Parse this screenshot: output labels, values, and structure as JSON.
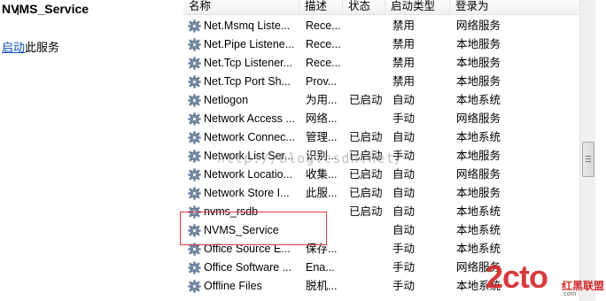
{
  "left_pane": {
    "service_title": "NVMS_Service",
    "start_link": "启动",
    "start_text": "此服务"
  },
  "columns": {
    "name": "名称",
    "desc": "描述",
    "status": "状态",
    "startup": "启动类型",
    "logon": "登录为"
  },
  "rows": [
    {
      "name": "Net.Msmq Liste...",
      "desc": "Rece...",
      "status": "",
      "startup": "禁用",
      "logon": "网络服务"
    },
    {
      "name": "Net.Pipe Listene...",
      "desc": "Rece...",
      "status": "",
      "startup": "禁用",
      "logon": "本地服务"
    },
    {
      "name": "Net.Tcp Listener...",
      "desc": "Rece...",
      "status": "",
      "startup": "禁用",
      "logon": "本地服务"
    },
    {
      "name": "Net.Tcp Port Sh...",
      "desc": "Prov...",
      "status": "",
      "startup": "禁用",
      "logon": "本地服务"
    },
    {
      "name": "Netlogon",
      "desc": "为用...",
      "status": "已启动",
      "startup": "自动",
      "logon": "本地系统"
    },
    {
      "name": "Network Access ...",
      "desc": "网络...",
      "status": "",
      "startup": "手动",
      "logon": "网络服务"
    },
    {
      "name": "Network Connec...",
      "desc": "管理...",
      "status": "已启动",
      "startup": "自动",
      "logon": "本地系统"
    },
    {
      "name": "Network List Ser...",
      "desc": "识别...",
      "status": "已启动",
      "startup": "手动",
      "logon": "本地服务"
    },
    {
      "name": "Network Locatio...",
      "desc": "收集...",
      "status": "已启动",
      "startup": "自动",
      "logon": "网络服务"
    },
    {
      "name": "Network Store I...",
      "desc": "此服...",
      "status": "已启动",
      "startup": "自动",
      "logon": "本地服务"
    },
    {
      "name": "nvms_rsdb",
      "desc": "",
      "status": "已启动",
      "startup": "自动",
      "logon": "本地系统"
    },
    {
      "name": "NVMS_Service",
      "desc": "",
      "status": "",
      "startup": "自动",
      "logon": "本地系统"
    },
    {
      "name": "Office  Source E...",
      "desc": "保存...",
      "status": "",
      "startup": "手动",
      "logon": "本地系统"
    },
    {
      "name": "Office Software ...",
      "desc": "Ena...",
      "status": "",
      "startup": "手动",
      "logon": "网络服务"
    },
    {
      "name": "Offline Files",
      "desc": "脱机...",
      "status": "",
      "startup": "手动",
      "logon": "本地系统"
    }
  ],
  "watermark": "http://blog.csdn.net/",
  "logo": {
    "main": "2cto",
    "sub": "红黑联盟",
    "url": ".com"
  }
}
